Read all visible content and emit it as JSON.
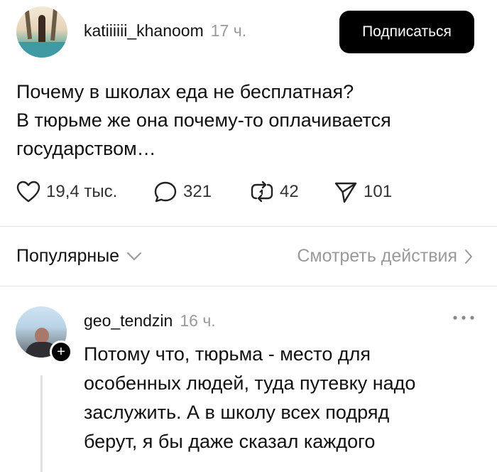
{
  "post": {
    "username": "katiiiiii_khanoom",
    "time": "17 ч.",
    "subscribe_label": "Подписаться",
    "text_lines": [
      "Почему в школах еда не бесплатная?",
      "В тюрьме же она почему-то оплачивается",
      "государством…"
    ],
    "stats": {
      "likes": "19,4 тыс.",
      "comments": "321",
      "reposts": "42",
      "shares": "101"
    }
  },
  "replies_bar": {
    "sort_label": "Популярные",
    "view_activity_label": "Смотреть действия"
  },
  "reply": {
    "username": "geo_tendzin",
    "time": "16 ч.",
    "text_lines": [
      "Потому что, тюрьма - место для",
      "особенных людей, туда путевку надо",
      "заслужить. А в школу всех подряд",
      "берут, я бы даже сказал каждого"
    ]
  }
}
